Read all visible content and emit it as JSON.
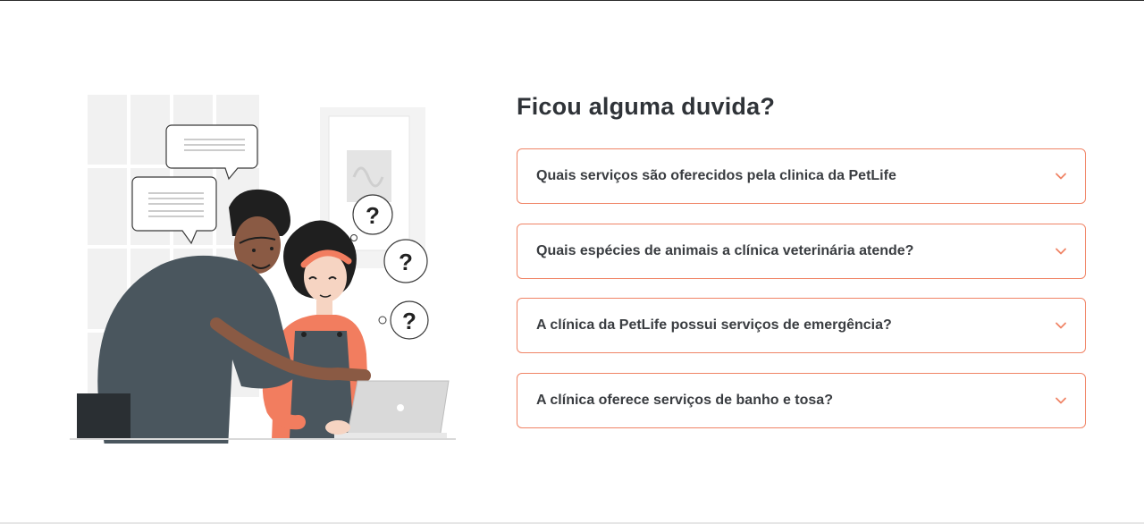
{
  "faq": {
    "title": "Ficou alguma duvida?",
    "items": [
      {
        "question": "Quais serviços são oferecidos pela clinica da PetLife"
      },
      {
        "question": "Quais espécies de animais a clínica veterinária atende?"
      },
      {
        "question": "A clínica da PetLife possui serviços de emergência?"
      },
      {
        "question": "A clínica oferece serviços de banho e tosa?"
      }
    ]
  },
  "illustration": {
    "bubble_marks": [
      "?",
      "?",
      "?"
    ]
  },
  "colors": {
    "accent": "#f08466",
    "heading": "#2f3338",
    "text": "#3a3d41",
    "skin_dark": "#8a5a44",
    "shirt": "#4a565e",
    "top_orange": "#f27d5f"
  },
  "icons": {
    "faq_toggle": "chevron-down-icon"
  }
}
